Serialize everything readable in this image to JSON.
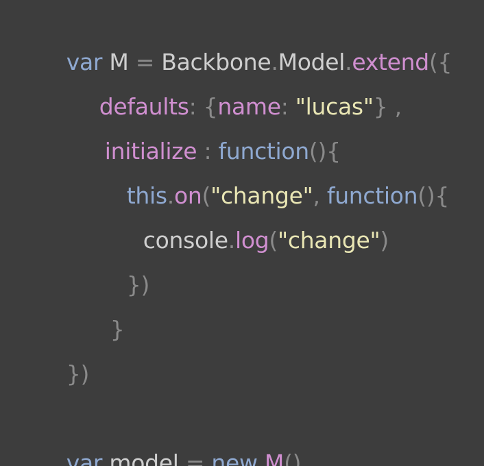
{
  "colors": {
    "background": "#3d3d3d",
    "keyword": "#8fa9d1",
    "identifier": "#cfcfcf",
    "property": "#d08fd0",
    "string": "#e9e6b4",
    "punctuation": "#8a8a8a"
  },
  "code": {
    "l1": {
      "t1": "var",
      "t2": " M ",
      "t3": "=",
      "t4": " Backbone",
      "t5": ".",
      "t6": "Model",
      "t7": ".",
      "t8": "extend",
      "t9": "({"
    },
    "l2": {
      "t1": "defaults",
      "t2": ": {",
      "t3": "name",
      "t4": ": ",
      "t5": "\"lucas\"",
      "t6": "} ,"
    },
    "l3": {
      "t1": "initialize",
      "t2": " : ",
      "t3": "function",
      "t4": "(){"
    },
    "l4": {
      "t1": "this",
      "t2": ".",
      "t3": "on",
      "t4": "(",
      "t5": "\"change\"",
      "t6": ", ",
      "t7": "function",
      "t8": "(){"
    },
    "l5": {
      "t1": "console",
      "t2": ".",
      "t3": "log",
      "t4": "(",
      "t5": "\"change\"",
      "t6": ")"
    },
    "l6": {
      "t1": "})"
    },
    "l7": {
      "t1": "}"
    },
    "l8": {
      "t1": "})"
    },
    "l10": {
      "t1": "var",
      "t2": " model ",
      "t3": "=",
      "t4": " new ",
      "t5": "M",
      "t6": "()"
    }
  }
}
